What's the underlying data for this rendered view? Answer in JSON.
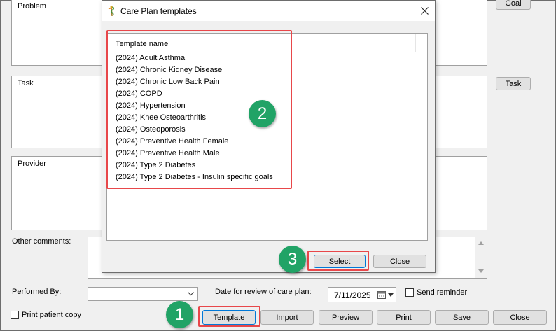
{
  "panels": {
    "problem_label": "Problem",
    "task_label": "Task",
    "provider_label": "Provider"
  },
  "right_buttons": {
    "goal": "Goal",
    "task": "Task"
  },
  "other_comments_label": "Other comments:",
  "performed_by_label": "Performed By:",
  "review_date_label": "Date for review of care plan:",
  "review_date_value": "7/11/2025",
  "send_reminder_label": "Send reminder",
  "print_copy_label": "Print patient copy",
  "bottom_buttons": {
    "template": "Template",
    "import": "Import",
    "preview": "Preview",
    "print": "Print",
    "save": "Save",
    "close": "Close"
  },
  "dialog": {
    "title": "Care Plan templates",
    "column_header": "Template name",
    "templates": [
      "(2024) Adult Asthma",
      "(2024) Chronic Kidney Disease",
      "(2024) Chronic Low Back Pain",
      "(2024) COPD",
      "(2024) Hypertension",
      "(2024) Knee Osteoarthritis",
      "(2024) Osteoporosis",
      "(2024) Preventive Health Female",
      "(2024) Preventive Health Male",
      "(2024) Type 2 Diabetes",
      "(2024) Type 2 Diabetes - Insulin specific goals"
    ],
    "select_label": "Select",
    "close_label": "Close"
  },
  "callouts": {
    "one": "1",
    "two": "2",
    "three": "3"
  },
  "colors": {
    "annotation": "#e8474a",
    "callout": "#21a366"
  },
  "icons": {
    "app": "caduceus-icon",
    "close": "close-icon",
    "calendar": "calendar-icon",
    "dropdown": "chevron-down-icon"
  }
}
